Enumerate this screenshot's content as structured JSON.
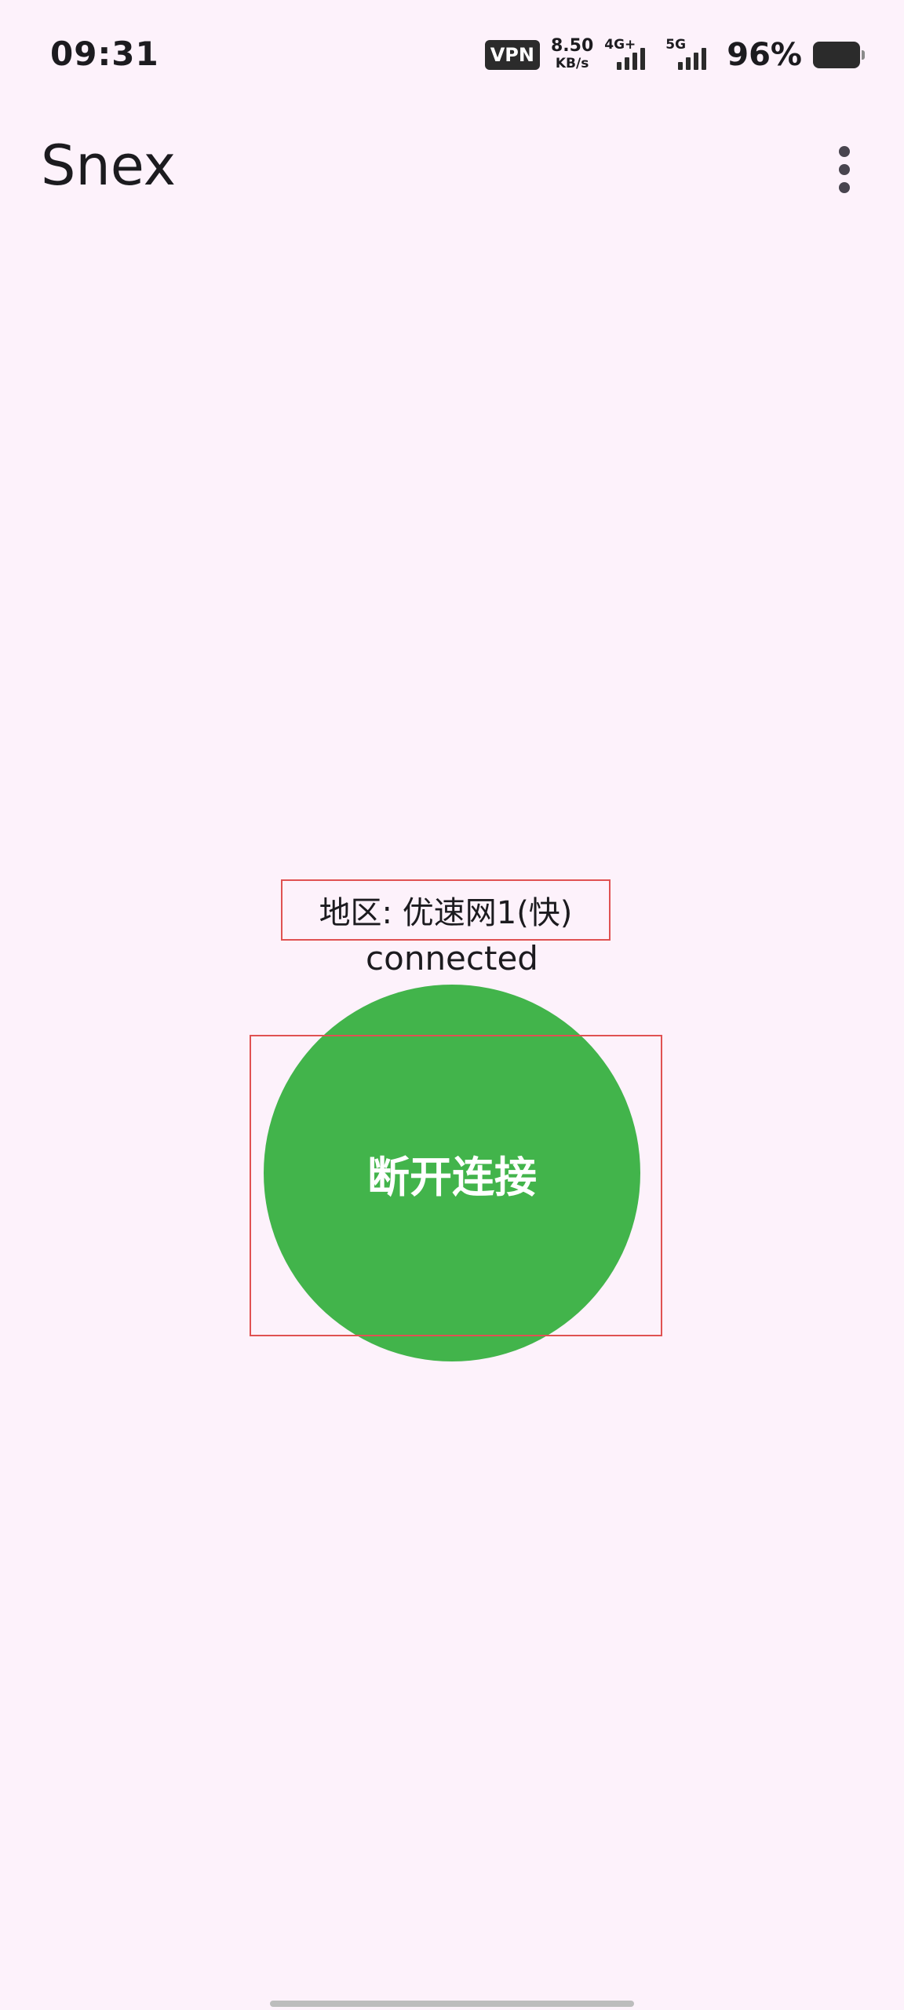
{
  "status_bar": {
    "time": "09:31",
    "vpn": "VPN",
    "net_speed_value": "8.50",
    "net_speed_unit": "KB/s",
    "signal1_label": "4G+",
    "signal2_label": "5G",
    "battery": "96%"
  },
  "app_bar": {
    "title": "Snex",
    "menu_icon": "more-vert-icon"
  },
  "main": {
    "region": "地区: 优速网1(快)",
    "status": "connected",
    "button_label": "断开连接",
    "button_color": "#42b44b",
    "highlight_color": "#e05252"
  },
  "colors": {
    "background": "#fdf2fb",
    "text": "#1c1b1f"
  }
}
